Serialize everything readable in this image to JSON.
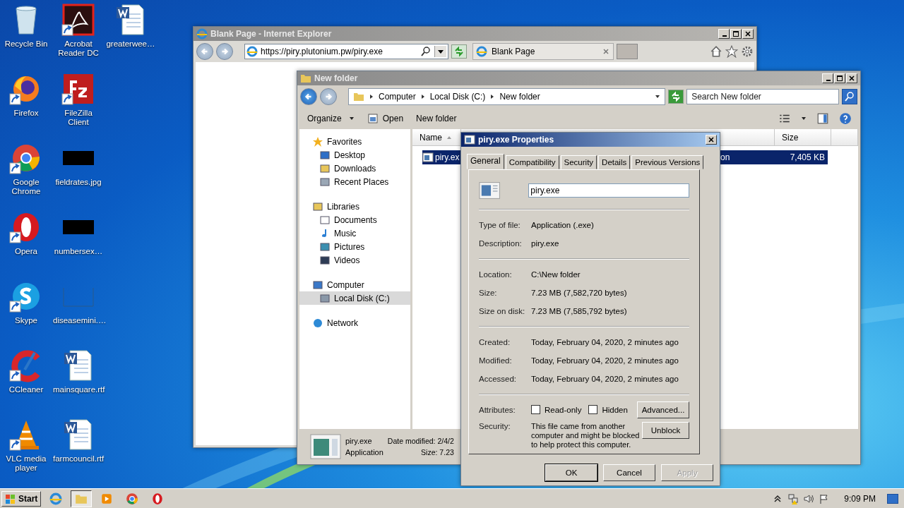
{
  "desktop_icons": [
    {
      "label": "Recycle Bin",
      "kind": "recycle",
      "shortcut": false
    },
    {
      "label": "Firefox",
      "kind": "firefox",
      "shortcut": true
    },
    {
      "label": "Google Chrome",
      "kind": "chrome",
      "shortcut": true
    },
    {
      "label": "Opera",
      "kind": "opera",
      "shortcut": true
    },
    {
      "label": "Skype",
      "kind": "skype",
      "shortcut": true
    },
    {
      "label": "CCleaner",
      "kind": "ccleaner",
      "shortcut": true
    },
    {
      "label": "VLC media player",
      "kind": "vlc",
      "shortcut": true
    },
    {
      "label": "Acrobat Reader DC",
      "kind": "acrobat",
      "shortcut": true
    },
    {
      "label": "FileZilla Client",
      "kind": "filezilla",
      "shortcut": true
    },
    {
      "label": "fieldrates.jpg",
      "kind": "image",
      "shortcut": false
    },
    {
      "label": "numbersex…",
      "kind": "image",
      "shortcut": false
    },
    {
      "label": "diseasemini.…",
      "kind": "blank",
      "shortcut": false
    },
    {
      "label": "mainsquare.rtf",
      "kind": "word",
      "shortcut": false
    },
    {
      "label": "farmcouncil.rtf",
      "kind": "word",
      "shortcut": false
    },
    {
      "label": "greaterwee…",
      "kind": "word",
      "shortcut": false
    }
  ],
  "ie_window": {
    "title": "Blank Page - Internet Explorer",
    "address": "https://piry.plutonium.pw/piry.exe",
    "tab": "Blank Page"
  },
  "explorer": {
    "title": "New folder",
    "breadcrumb": [
      "Computer",
      "Local Disk (C:)",
      "New folder"
    ],
    "search_placeholder": "Search New folder",
    "toolbar": [
      {
        "label": "Organize",
        "kind": "menu"
      },
      {
        "label": "Open",
        "kind": "open"
      },
      {
        "label": "New folder",
        "kind": "plain"
      }
    ],
    "nav": [
      {
        "label": "Favorites",
        "kind": "star",
        "selected": false,
        "children": [
          {
            "label": "Desktop",
            "kind": "desktop",
            "selected": false
          },
          {
            "label": "Downloads",
            "kind": "downloads",
            "selected": false
          },
          {
            "label": "Recent Places",
            "kind": "recent",
            "selected": false
          }
        ]
      },
      {
        "label": "Libraries",
        "kind": "library",
        "selected": false,
        "children": [
          {
            "label": "Documents",
            "kind": "doc",
            "selected": false
          },
          {
            "label": "Music",
            "kind": "music",
            "selected": false
          },
          {
            "label": "Pictures",
            "kind": "pictures",
            "selected": false
          },
          {
            "label": "Videos",
            "kind": "videos",
            "selected": false
          }
        ]
      },
      {
        "label": "Computer",
        "kind": "computer",
        "selected": false,
        "children": [
          {
            "label": "Local Disk (C:)",
            "kind": "disk",
            "selected": true
          }
        ]
      },
      {
        "label": "Network",
        "kind": "network",
        "selected": false
      }
    ],
    "columns": [
      "Name",
      "Size"
    ],
    "files": [
      {
        "name": "piry.ex",
        "type": "on",
        "size": "7,405 KB",
        "selected": true
      }
    ],
    "details": {
      "name": "piry.exe",
      "type": "Application",
      "modified": "Date modified: 2/4/2",
      "size": "Size: 7.23"
    }
  },
  "dialog": {
    "title": "piry.exe Properties",
    "tabs": [
      {
        "label": "General",
        "selected": true
      },
      {
        "label": "Compatibility",
        "selected": false
      },
      {
        "label": "Security",
        "selected": false
      },
      {
        "label": "Details",
        "selected": false
      },
      {
        "label": "Previous Versions",
        "selected": false
      }
    ],
    "file_name": "piry.exe",
    "sections": [
      [
        {
          "label": "Type of file:",
          "value": "Application (.exe)"
        },
        {
          "label": "Description:",
          "value": "piry.exe"
        }
      ],
      [
        {
          "label": "Location:",
          "value": "C:\\New folder"
        },
        {
          "label": "Size:",
          "value": "7.23 MB (7,582,720 bytes)"
        },
        {
          "label": "Size on disk:",
          "value": "7.23 MB (7,585,792 bytes)"
        }
      ],
      [
        {
          "label": "Created:",
          "value": "Today, February 04, 2020, 2 minutes ago"
        },
        {
          "label": "Modified:",
          "value": "Today, February 04, 2020, 2 minutes ago"
        },
        {
          "label": "Accessed:",
          "value": "Today, February 04, 2020, 2 minutes ago"
        }
      ]
    ],
    "attributes_label": "Attributes:",
    "attributes": [
      {
        "label": "Read-only",
        "checked": false
      },
      {
        "label": "Hidden",
        "checked": false
      }
    ],
    "advanced_button": "Advanced...",
    "security_label": "Security:",
    "security_text": "This file came from another computer and might be blocked to help protect this computer.",
    "unblock_button": "Unblock",
    "buttons": [
      {
        "label": "OK",
        "default": true,
        "disabled": false
      },
      {
        "label": "Cancel",
        "default": false,
        "disabled": false
      },
      {
        "label": "Apply",
        "default": false,
        "disabled": true
      }
    ]
  },
  "taskbar": {
    "start": "Start",
    "tasks": [
      {
        "kind": "ie",
        "selected": false
      },
      {
        "kind": "explorer",
        "selected": true
      },
      {
        "kind": "media",
        "selected": false
      },
      {
        "kind": "chrome",
        "selected": false
      },
      {
        "kind": "opera",
        "selected": false
      }
    ],
    "clock": "9:09 PM"
  }
}
